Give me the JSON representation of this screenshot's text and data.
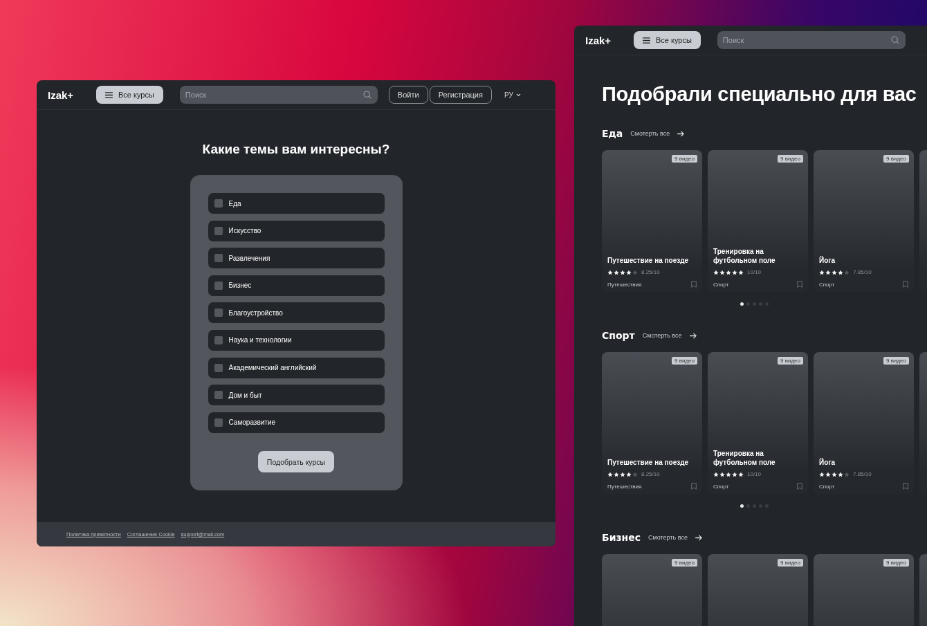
{
  "left_window": {
    "header": {
      "logo": "Izak+",
      "courses_button": "Все курсы",
      "search": {
        "placeholder": "Поиск"
      },
      "login_button": "Войти",
      "register_button": "Регистрация",
      "language": "РУ"
    },
    "title": "Какие темы вам интересны?",
    "topics": [
      {
        "label": "Еда",
        "checked": false
      },
      {
        "label": "Искусство",
        "checked": false
      },
      {
        "label": "Развлечения",
        "checked": false
      },
      {
        "label": "Бизнес",
        "checked": false
      },
      {
        "label": "Благоустройство",
        "checked": false
      },
      {
        "label": "Наука и технологии",
        "checked": false
      },
      {
        "label": "Академический английский",
        "checked": false
      },
      {
        "label": "Дом и быт",
        "checked": false
      },
      {
        "label": "Саморазвитие",
        "checked": false
      }
    ],
    "submit_button": "Подобрать курсы",
    "footer_links": [
      "Политика приватности",
      "Соглашение Cookie",
      "support@mail.com"
    ]
  },
  "right_window": {
    "header": {
      "logo": "Izak+",
      "courses_button": "Все курсы",
      "search": {
        "placeholder": "Поиск"
      }
    },
    "title": "Подобрали специально для вас",
    "sections": [
      {
        "title": "Еда",
        "see_all": "Смотерть все",
        "cards": [
          {
            "badge": "9 видео",
            "title": "Путешествие на поезде",
            "stars": 4,
            "rating": "8.25/10",
            "category": "Путешествия"
          },
          {
            "badge": "9 видео",
            "title": "Тренировка на футбольном поле",
            "stars": 5,
            "rating": "10/10",
            "category": "Спорт"
          },
          {
            "badge": "9 видео",
            "title": "Йога",
            "stars": 4,
            "rating": "7.85/10",
            "category": "Спорт"
          }
        ],
        "pages": [
          {
            "selected": true
          },
          {
            "selected": false
          },
          {
            "selected": false
          },
          {
            "selected": false
          },
          {
            "selected": false
          }
        ]
      },
      {
        "title": "Спорт",
        "see_all": "Смотерть все",
        "cards": [
          {
            "badge": "9 видео",
            "title": "Путешествие на поезде",
            "stars": 4,
            "rating": "8.25/10",
            "category": "Путешествия"
          },
          {
            "badge": "9 видео",
            "title": "Тренировка на футбольном поле",
            "stars": 5,
            "rating": "10/10",
            "category": "Спорт"
          },
          {
            "badge": "9 видео",
            "title": "Йога",
            "stars": 4,
            "rating": "7.85/10",
            "category": "Спорт"
          }
        ],
        "pages": [
          {
            "selected": true
          },
          {
            "selected": false
          },
          {
            "selected": false
          },
          {
            "selected": false
          },
          {
            "selected": false
          }
        ]
      },
      {
        "title": "Бизнес",
        "see_all": "Смотерть все",
        "cards": [
          {
            "badge": "9 видео"
          },
          {
            "badge": "9 видео"
          },
          {
            "badge": "9 видео"
          }
        ]
      }
    ]
  }
}
